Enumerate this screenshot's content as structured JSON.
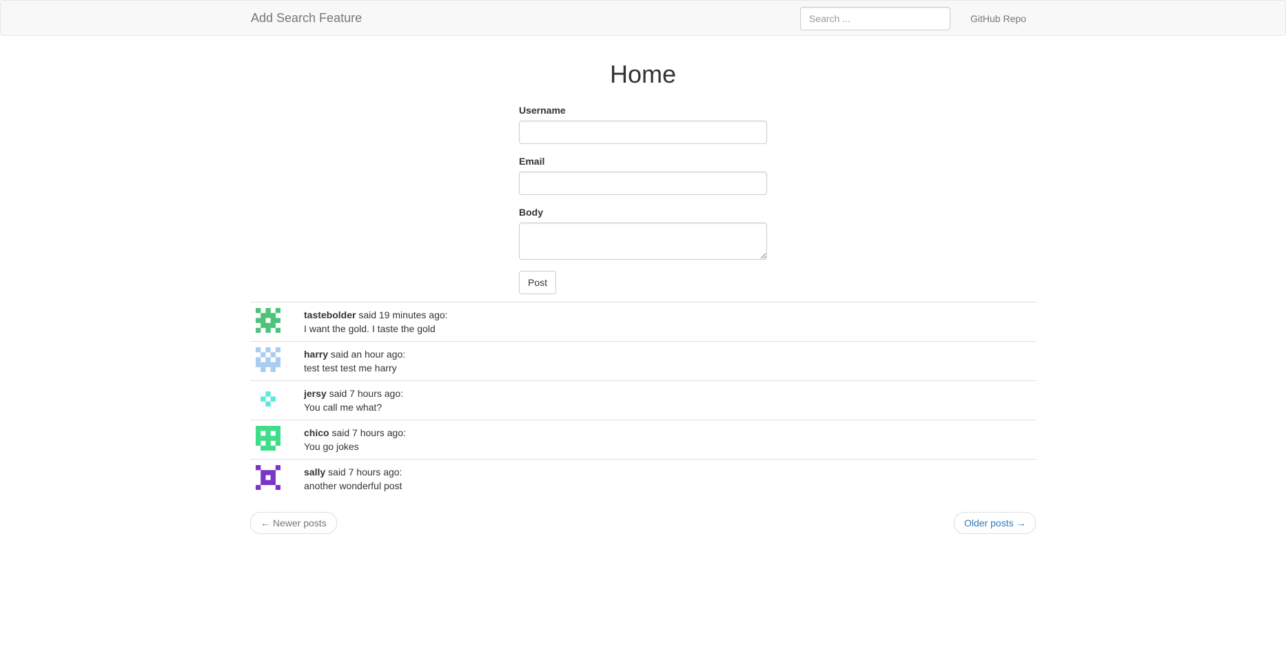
{
  "navbar": {
    "brand": "Add Search Feature",
    "search_placeholder": "Search ...",
    "search_value": "",
    "github_link": "GitHub Repo"
  },
  "page": {
    "title": "Home"
  },
  "form": {
    "username_label": "Username",
    "username_value": "",
    "email_label": "Email",
    "email_value": "",
    "body_label": "Body",
    "body_value": "",
    "submit_label": "Post"
  },
  "posts": [
    {
      "author": "tastebolder",
      "meta": " said 19 minutes ago:",
      "body": "I want the gold. I taste the gold",
      "avatar_icon": "identicon-avatar",
      "avatar_color": "#4dc37a"
    },
    {
      "author": "harry",
      "meta": " said an hour ago:",
      "body": "test test test me harry",
      "avatar_icon": "identicon-avatar",
      "avatar_color": "#a9cdf0"
    },
    {
      "author": "jersy",
      "meta": " said 7 hours ago:",
      "body": "You call me what?",
      "avatar_icon": "identicon-avatar",
      "avatar_color": "#5be8dc"
    },
    {
      "author": "chico",
      "meta": " said 7 hours ago:",
      "body": "You go jokes",
      "avatar_icon": "identicon-avatar",
      "avatar_color": "#3fdc8a"
    },
    {
      "author": "sally",
      "meta": " said 7 hours ago:",
      "body": "another wonderful post",
      "avatar_icon": "identicon-avatar",
      "avatar_color": "#7a35c8"
    }
  ],
  "pager": {
    "newer_label": "← Newer posts",
    "older_label": "Older posts →"
  },
  "colors": {
    "link": "#337ab7",
    "navbar_bg": "#f8f8f8"
  }
}
